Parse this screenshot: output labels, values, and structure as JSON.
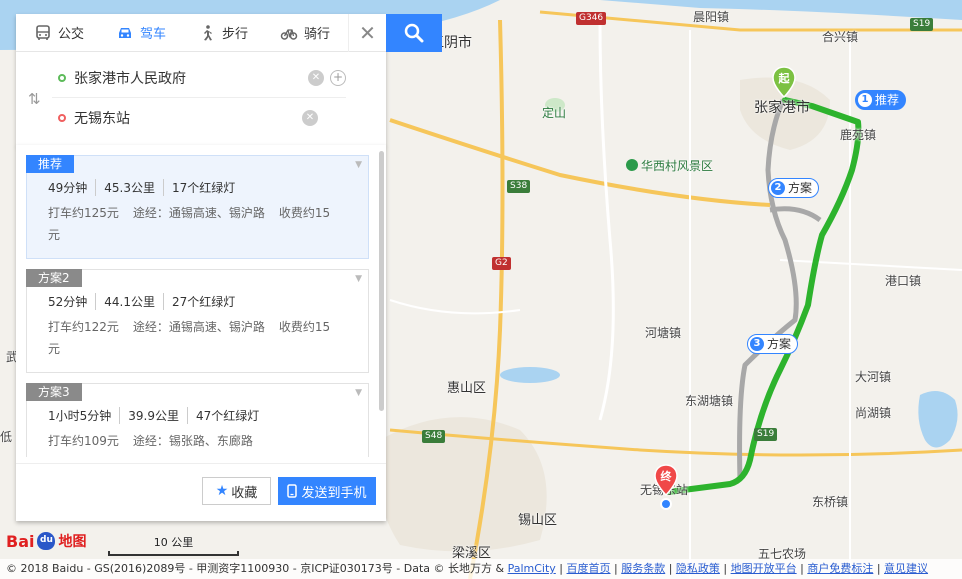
{
  "colors": {
    "accent": "#3385ff",
    "route_green": "#2db32d",
    "route_gray": "#a8a8a8"
  },
  "modes": [
    {
      "label": "公交",
      "icon": "bus-icon"
    },
    {
      "label": "驾车",
      "icon": "car-icon"
    },
    {
      "label": "步行",
      "icon": "walk-icon"
    },
    {
      "label": "骑行",
      "icon": "bike-icon"
    }
  ],
  "active_mode": "驾车",
  "start_value": "张家港市人民政府",
  "end_value": "无锡东站",
  "plans": [
    {
      "tag": "推荐",
      "time": "49分钟",
      "distance": "45.3公里",
      "lights": "17个红绿灯",
      "taxi": "打车约125元",
      "via": "途经：通锡高速、锡沪路",
      "toll": "收费约15",
      "toll_cont": "元"
    },
    {
      "tag": "方案2",
      "time": "52分钟",
      "distance": "44.1公里",
      "lights": "27个红绿灯",
      "taxi": "打车约122元",
      "via": "途经：通锡高速、锡沪路",
      "toll": "收费约15",
      "toll_cont": "元"
    },
    {
      "tag": "方案3",
      "time": "1小时5分钟",
      "distance": "39.9公里",
      "lights": "47个红绿灯",
      "taxi": "打车约109元",
      "via": "途经：锡张路、东廊路"
    }
  ],
  "actions": {
    "favorite": "收藏",
    "send": "发送到手机"
  },
  "map": {
    "labels": {
      "jiangyin": "江阴市",
      "dingshan": "定山",
      "zhangjiagang": "张家港市",
      "lumiao": "鹿苑镇",
      "chenyang": "晨阳镇",
      "hexing": "合兴镇",
      "huaxi": "华西村风景区",
      "gangkou": "港口镇",
      "hetang": "河塘镇",
      "huishan": "惠山区",
      "dongtang": "东湖塘镇",
      "dahe": "大河镇",
      "shanghu": "尚湖镇",
      "wuxi_east": "无锡东站",
      "xishan": "锡山区",
      "dongqiao": "东桥镇",
      "liangxi": "梁溪区",
      "wuqi": "五七农场",
      "left_wu": "武",
      "left_di": "低"
    },
    "shields": {
      "g346": "G346",
      "s19a": "S19",
      "s38": "S38",
      "g2": "G2",
      "s19b": "S19",
      "s48": "S48"
    },
    "start_marker": "起",
    "end_marker": "终",
    "route_tags": [
      {
        "num": "1",
        "label": "推荐"
      },
      {
        "num": "2",
        "label": "方案"
      },
      {
        "num": "3",
        "label": "方案"
      }
    ]
  },
  "scale_label": "10 公里",
  "logo": {
    "bai": "Bai",
    "du": "du",
    "ditu": "地图"
  },
  "footer": {
    "copyright": "© 2018 Baidu - GS(2016)2089号 - 甲测资字1100930 - 京ICP证030173号 - Data © 长地万方 & ",
    "links": [
      "PalmCity",
      "百度首页",
      "服务条款",
      "隐私政策",
      "地图开放平台",
      "商户免费标注",
      "意见建议"
    ],
    "separator": " | "
  }
}
